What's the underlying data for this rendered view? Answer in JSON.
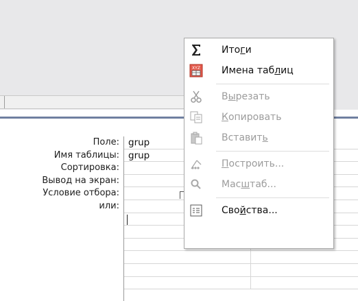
{
  "grid": {
    "row_labels": [
      "Поле:",
      "Имя таблицы:",
      "Сортировка:",
      "Вывод на экран:",
      "Условие отбора:",
      "или:"
    ],
    "col1": {
      "field": "grup",
      "table": "grup"
    }
  },
  "menu": {
    "items": [
      {
        "icon": "sigma-icon",
        "pre": "Ито",
        "acc": "г",
        "post": "и",
        "enabled": true
      },
      {
        "icon": "table-names-icon",
        "pre": "Имена таб",
        "acc": "л",
        "post": "иц",
        "enabled": true
      },
      {
        "icon": "scissors-icon",
        "pre": "В",
        "acc": "ы",
        "post": "резать",
        "enabled": false
      },
      {
        "icon": "copy-icon",
        "pre": "",
        "acc": "К",
        "post": "опировать",
        "enabled": false
      },
      {
        "icon": "paste-icon",
        "pre": "Вставит",
        "acc": "ь",
        "post": "",
        "enabled": false
      },
      {
        "icon": "build-icon",
        "pre": "",
        "acc": "П",
        "post": "остроить...",
        "enabled": false
      },
      {
        "icon": "zoom-icon",
        "pre": "Мас",
        "acc": "ш",
        "post": "таб...",
        "enabled": false
      },
      {
        "icon": "properties-icon",
        "pre": "Сво",
        "acc": "й",
        "post": "ства...",
        "enabled": true
      }
    ]
  },
  "colors": {
    "splitter": "#6f7fa0",
    "icon_red": "#c0392b"
  }
}
